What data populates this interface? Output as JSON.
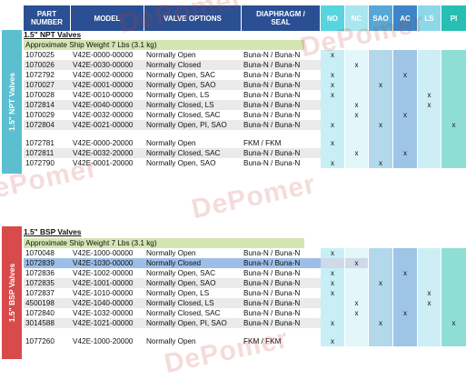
{
  "header": {
    "part_number": "PART\nNUMBER",
    "model": "MODEL",
    "valve_options": "VALVE OPTIONS",
    "diaphragm_seal": "DIAPHRAGM /\nSEAL",
    "flags": [
      "NO",
      "NC",
      "SAO",
      "AC",
      "LS",
      "PI"
    ]
  },
  "colors": {
    "header_bg": "#2b4f93",
    "flag_headers": [
      "#56d4e0",
      "#a9e6ee",
      "#56a9d6",
      "#3d85c6",
      "#8ed7e8",
      "#27bfb4"
    ],
    "flag_cells": [
      "#c8eff5",
      "#e3f6f9",
      "#b3d8ec",
      "#9ec5e6",
      "#cdeef4",
      "#8fded6"
    ],
    "npt_sidebar": "#5bbfd0",
    "bsp_sidebar": "#d94b4b",
    "ship_bar": "#d3e6b2"
  },
  "npt": {
    "sidebar_label": "1.5\" NPT Valves",
    "title": "1.5\" NPT Valves",
    "ship_weight": "Approximate Ship Weight 7 Lbs (3.1 kg)",
    "rows": [
      {
        "part": "1070025",
        "model": "V42E-0000-00000",
        "option": "Normally Open",
        "seal": "Buna-N / Buna-N",
        "flags": [
          "x",
          "",
          "",
          "",
          "",
          ""
        ]
      },
      {
        "part": "1070026",
        "model": "V42E-0030-00000",
        "option": "Normally Closed",
        "seal": "Buna-N / Buna-N",
        "flags": [
          "",
          "x",
          "",
          "",
          "",
          ""
        ]
      },
      {
        "part": "1072792",
        "model": "V42E-0002-00000",
        "option": "Normally Open, SAC",
        "seal": "Buna-N / Buna-N",
        "flags": [
          "x",
          "",
          "",
          "x",
          "",
          ""
        ]
      },
      {
        "part": "1070027",
        "model": "V42E-0001-00000",
        "option": "Normally Open, SAO",
        "seal": "Buna-N / Buna-N",
        "flags": [
          "x",
          "",
          "x",
          "",
          "",
          ""
        ]
      },
      {
        "part": "1070028",
        "model": "V42E-0010-00000",
        "option": "Normally Open, LS",
        "seal": "Buna-N / Buna-N",
        "flags": [
          "x",
          "",
          "",
          "",
          "x",
          ""
        ]
      },
      {
        "part": "1072814",
        "model": "V42E-0040-00000",
        "option": "Normally Closed, LS",
        "seal": "Buna-N / Buna-N",
        "flags": [
          "",
          "x",
          "",
          "",
          "x",
          ""
        ]
      },
      {
        "part": "1070029",
        "model": "V42E-0032-00000",
        "option": "Normally Closed, SAC",
        "seal": "Buna-N / Buna-N",
        "flags": [
          "",
          "x",
          "",
          "x",
          "",
          ""
        ]
      },
      {
        "part": "1072804",
        "model": "V42E-0021-00000",
        "option": "Normally Open, PI, SAO",
        "seal": "Buna-N / Buna-N",
        "flags": [
          "x",
          "",
          "x",
          "",
          "",
          "x"
        ]
      },
      {
        "gap": true
      },
      {
        "part": "1072781",
        "model": "V42E-0000-20000",
        "option": "Normally Open",
        "seal": "FKM / FKM",
        "flags": [
          "x",
          "",
          "",
          "",
          "",
          ""
        ]
      },
      {
        "part": "1072811",
        "model": "V42E-0032-20000",
        "option": "Normally Closed, SAC",
        "seal": "Buna-N / Buna-N",
        "flags": [
          "",
          "x",
          "",
          "x",
          "",
          ""
        ]
      },
      {
        "part": "1072790",
        "model": "V42E-0001-20000",
        "option": "Normally Open, SAO",
        "seal": "Buna-N / Buna-N",
        "flags": [
          "x",
          "",
          "x",
          "",
          "",
          ""
        ]
      }
    ]
  },
  "bsp": {
    "sidebar_label": "1.5\" BSP Valves",
    "title": "1.5\" BSP Valves",
    "ship_weight": "Approximate Ship Weight 7 Lbs (3.1 kg)",
    "rows": [
      {
        "part": "1070048",
        "model": "V42E-1000-00000",
        "option": "Normally Open",
        "seal": "Buna-N / Buna-N",
        "flags": [
          "x",
          "",
          "",
          "",
          "",
          ""
        ]
      },
      {
        "part": "1072839",
        "model": "V42E-1030-00000",
        "option": "Normally Closed",
        "seal": "Buna-N / Buna-N",
        "flags": [
          "",
          "x",
          "",
          "",
          "",
          ""
        ],
        "selected": true
      },
      {
        "part": "1072836",
        "model": "V42E-1002-00000",
        "option": "Normally Open, SAC",
        "seal": "Buna-N / Buna-N",
        "flags": [
          "x",
          "",
          "",
          "x",
          "",
          ""
        ]
      },
      {
        "part": "1072835",
        "model": "V42E-1001-00000",
        "option": "Normally Open, SAO",
        "seal": "Buna-N / Buna-N",
        "flags": [
          "x",
          "",
          "x",
          "",
          "",
          ""
        ]
      },
      {
        "part": "1072837",
        "model": "V42E-1010-00000",
        "option": "Normally Open, LS",
        "seal": "Buna-N / Buna-N",
        "flags": [
          "x",
          "",
          "",
          "",
          "x",
          ""
        ]
      },
      {
        "part": "4500198",
        "model": "V42E-1040-00000",
        "option": "Normally Closed, LS",
        "seal": "Buna-N / Buna-N",
        "flags": [
          "",
          "x",
          "",
          "",
          "x",
          ""
        ]
      },
      {
        "part": "1072840",
        "model": "V42E-1032-00000",
        "option": "Normally Closed, SAC",
        "seal": "Buna-N / Buna-N",
        "flags": [
          "",
          "x",
          "",
          "x",
          "",
          ""
        ]
      },
      {
        "part": "3014588",
        "model": "V42E-1021-00000",
        "option": "Normally Open, PI, SAO",
        "seal": "Buna-N / Buna-N",
        "flags": [
          "x",
          "",
          "x",
          "",
          "",
          "x"
        ]
      },
      {
        "gap": true
      },
      {
        "part": "1077260",
        "model": "V42E-1000-20000",
        "option": "Normally Open",
        "seal": "FKM / FKM",
        "flags": [
          "x",
          "",
          "",
          "",
          "",
          ""
        ]
      }
    ]
  },
  "watermark": "DePomer"
}
